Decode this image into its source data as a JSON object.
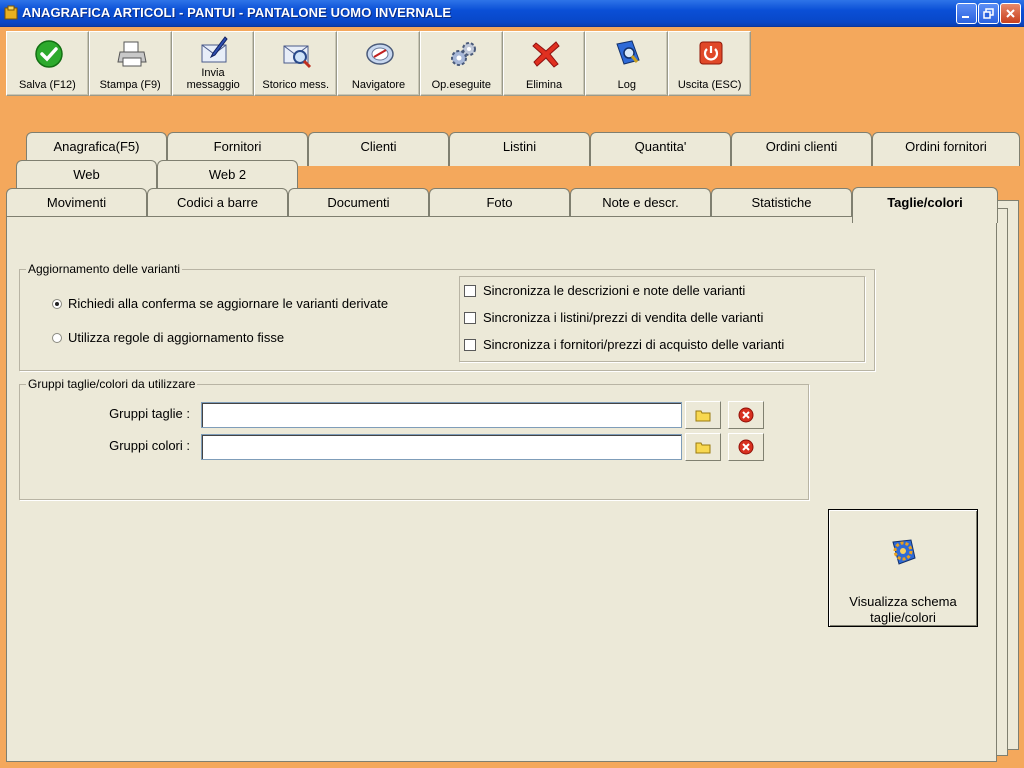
{
  "window": {
    "title": "ANAGRAFICA ARTICOLI - PANTUI - PANTALONE UOMO INVERNALE"
  },
  "toolbar": {
    "buttons": [
      {
        "label": "Salva (F12)",
        "icon": "checkmark-icon"
      },
      {
        "label": "Stampa (F9)",
        "icon": "printer-icon"
      },
      {
        "label": "Invia messaggio",
        "icon": "envelope-pen-icon"
      },
      {
        "label": "Storico mess.",
        "icon": "envelope-search-icon"
      },
      {
        "label": "Navigatore",
        "icon": "compass-icon"
      },
      {
        "label": "Op.eseguite",
        "icon": "gears-icon"
      },
      {
        "label": "Elimina",
        "icon": "red-x-icon"
      },
      {
        "label": "Log",
        "icon": "log-book-icon"
      },
      {
        "label": "Uscita (ESC)",
        "icon": "power-icon"
      }
    ]
  },
  "tabs": {
    "row1": [
      "Anagrafica(F5)",
      "Fornitori",
      "Clienti",
      "Listini",
      "Quantita'",
      "Ordini clienti",
      "Ordini fornitori"
    ],
    "row2": [
      "Web",
      "Web 2"
    ],
    "row3": [
      "Movimenti",
      "Codici a barre",
      "Documenti",
      "Foto",
      "Note e descr.",
      "Statistiche",
      "Taglie/colori"
    ],
    "active": "Taglie/colori"
  },
  "varianti": {
    "legend": "Aggiornamento delle varianti",
    "radio1": "Richiedi alla conferma se aggiornare le varianti derivate",
    "radio2": "Utilizza regole di aggiornamento fisse",
    "selected": 1,
    "check1": "Sincronizza le descrizioni e note delle varianti",
    "check2": "Sincronizza i listini/prezzi di vendita delle varianti",
    "check3": "Sincronizza i fornitori/prezzi di acquisto delle varianti"
  },
  "gruppi": {
    "legend": "Gruppi taglie/colori da utilizzare",
    "taglie_label": "Gruppi taglie :",
    "taglie_value": "",
    "colori_label": "Gruppi colori :",
    "colori_value": ""
  },
  "schema_button": {
    "label": "Visualizza schema taglie/colori"
  },
  "colors": {
    "titlebar": "#0A4FD6",
    "background": "#F4A85C",
    "panel": "#ECE9D8"
  }
}
